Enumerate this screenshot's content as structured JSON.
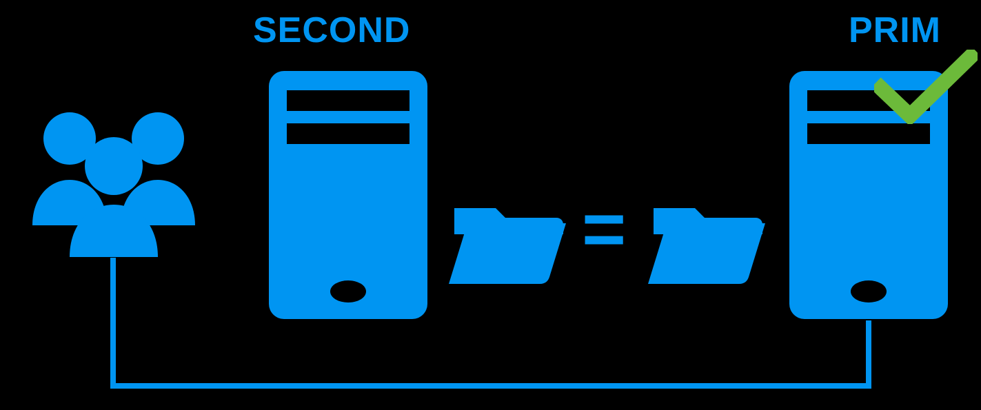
{
  "labels": {
    "second": "SECOND",
    "prim": "PRIM",
    "equals": "="
  },
  "colors": {
    "blue": "#0095f2",
    "green": "#6cba3a",
    "background": "#000000"
  },
  "icons": {
    "users_group": "users-group-icon",
    "server_secondary": "server-secondary-icon",
    "server_primary": "server-primary-icon",
    "folder_left": "folder-icon",
    "folder_right": "folder-icon",
    "checkmark": "checkmark-icon",
    "connector": "connector-line"
  }
}
